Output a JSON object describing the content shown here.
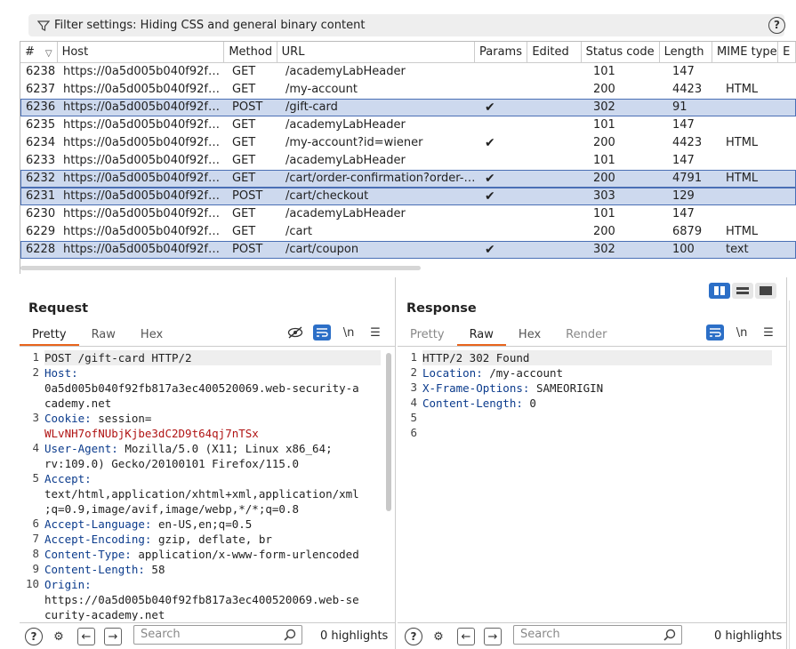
{
  "filter": {
    "text": "Filter settings: Hiding CSS and general binary content"
  },
  "table": {
    "headers": [
      "#",
      "Host",
      "Method",
      "URL",
      "Params",
      "Edited",
      "Status code",
      "Length",
      "MIME type",
      "E"
    ],
    "rows": [
      {
        "num": "6238",
        "host": "https://0a5d005b040f92fb81...",
        "method": "GET",
        "url": "/academyLabHeader",
        "params": "",
        "edited": "",
        "status": "101",
        "length": "147",
        "mime": "",
        "selected": false
      },
      {
        "num": "6237",
        "host": "https://0a5d005b040f92fb81...",
        "method": "GET",
        "url": "/my-account",
        "params": "",
        "edited": "",
        "status": "200",
        "length": "4423",
        "mime": "HTML",
        "selected": false
      },
      {
        "num": "6236",
        "host": "https://0a5d005b040f92fb81...",
        "method": "POST",
        "url": "/gift-card",
        "params": "✔",
        "edited": "",
        "status": "302",
        "length": "91",
        "mime": "",
        "selected": true
      },
      {
        "num": "6235",
        "host": "https://0a5d005b040f92fb81...",
        "method": "GET",
        "url": "/academyLabHeader",
        "params": "",
        "edited": "",
        "status": "101",
        "length": "147",
        "mime": "",
        "selected": false
      },
      {
        "num": "6234",
        "host": "https://0a5d005b040f92fb81...",
        "method": "GET",
        "url": "/my-account?id=wiener",
        "params": "✔",
        "edited": "",
        "status": "200",
        "length": "4423",
        "mime": "HTML",
        "selected": false
      },
      {
        "num": "6233",
        "host": "https://0a5d005b040f92fb81...",
        "method": "GET",
        "url": "/academyLabHeader",
        "params": "",
        "edited": "",
        "status": "101",
        "length": "147",
        "mime": "",
        "selected": false
      },
      {
        "num": "6232",
        "host": "https://0a5d005b040f92fb81...",
        "method": "GET",
        "url": "/cart/order-confirmation?order-co...",
        "params": "✔",
        "edited": "",
        "status": "200",
        "length": "4791",
        "mime": "HTML",
        "selected": true
      },
      {
        "num": "6231",
        "host": "https://0a5d005b040f92fb81...",
        "method": "POST",
        "url": "/cart/checkout",
        "params": "✔",
        "edited": "",
        "status": "303",
        "length": "129",
        "mime": "",
        "selected": true
      },
      {
        "num": "6230",
        "host": "https://0a5d005b040f92fb81...",
        "method": "GET",
        "url": "/academyLabHeader",
        "params": "",
        "edited": "",
        "status": "101",
        "length": "147",
        "mime": "",
        "selected": false
      },
      {
        "num": "6229",
        "host": "https://0a5d005b040f92fb81...",
        "method": "GET",
        "url": "/cart",
        "params": "",
        "edited": "",
        "status": "200",
        "length": "6879",
        "mime": "HTML",
        "selected": false
      },
      {
        "num": "6228",
        "host": "https://0a5d005b040f92fb81...",
        "method": "POST",
        "url": "/cart/coupon",
        "params": "✔",
        "edited": "",
        "status": "302",
        "length": "100",
        "mime": "text",
        "selected": true
      }
    ]
  },
  "request": {
    "title": "Request",
    "tabs": [
      "Pretty",
      "Raw",
      "Hex"
    ],
    "active_tab": "Pretty",
    "newline_label": "\\n",
    "search_placeholder": "Search",
    "highlights": "0 highlights",
    "lines": [
      {
        "n": "1",
        "key": "",
        "value": "POST /gift-card HTTP/2",
        "cont": []
      },
      {
        "n": "2",
        "key": "Host:",
        "value": "",
        "cont": [
          "0a5d005b040f92fb817a3ec400520069.web-security-a",
          "cademy.net"
        ]
      },
      {
        "n": "3",
        "key": "Cookie:",
        "value": " session=",
        "cont": [
          "WLvNH7ofNUbjKjbe3dC2D9t64qj7nTSx"
        ]
      },
      {
        "n": "4",
        "key": "User-Agent:",
        "value": " Mozilla/5.0 (X11; Linux x86_64;",
        "cont": [
          "rv:109.0) Gecko/20100101 Firefox/115.0"
        ]
      },
      {
        "n": "5",
        "key": "Accept:",
        "value": "",
        "cont": [
          "text/html,application/xhtml+xml,application/xml",
          ";q=0.9,image/avif,image/webp,*/*;q=0.8"
        ]
      },
      {
        "n": "6",
        "key": "Accept-Language:",
        "value": " en-US,en;q=0.5",
        "cont": []
      },
      {
        "n": "7",
        "key": "Accept-Encoding:",
        "value": " gzip, deflate, br",
        "cont": []
      },
      {
        "n": "8",
        "key": "Content-Type:",
        "value": " application/x-www-form-urlencoded",
        "cont": []
      },
      {
        "n": "9",
        "key": "Content-Length:",
        "value": " 58",
        "cont": []
      },
      {
        "n": "10",
        "key": "Origin:",
        "value": "",
        "cont": [
          "https://0a5d005b040f92fb817a3ec400520069.web-se",
          "curity-academy.net"
        ]
      }
    ]
  },
  "response": {
    "title": "Response",
    "tabs": [
      "Pretty",
      "Raw",
      "Hex",
      "Render"
    ],
    "active_tab": "Raw",
    "newline_label": "\\n",
    "search_placeholder": "Search",
    "highlights": "0 highlights",
    "lines": [
      {
        "n": "1",
        "key": "",
        "value": "HTTP/2 302 Found"
      },
      {
        "n": "2",
        "key": "Location:",
        "value": " /my-account"
      },
      {
        "n": "3",
        "key": "X-Frame-Options:",
        "value": " SAMEORIGIN"
      },
      {
        "n": "4",
        "key": "Content-Length:",
        "value": " 0"
      },
      {
        "n": "5",
        "key": "",
        "value": ""
      },
      {
        "n": "6",
        "key": "",
        "value": ""
      }
    ]
  },
  "colors": {
    "accent": "#2c6fc7",
    "tab_underline": "#e8641c",
    "selected_row": "#cdd9ee",
    "header_key": "#0b3b8c",
    "cookie_value": "#b01414"
  }
}
